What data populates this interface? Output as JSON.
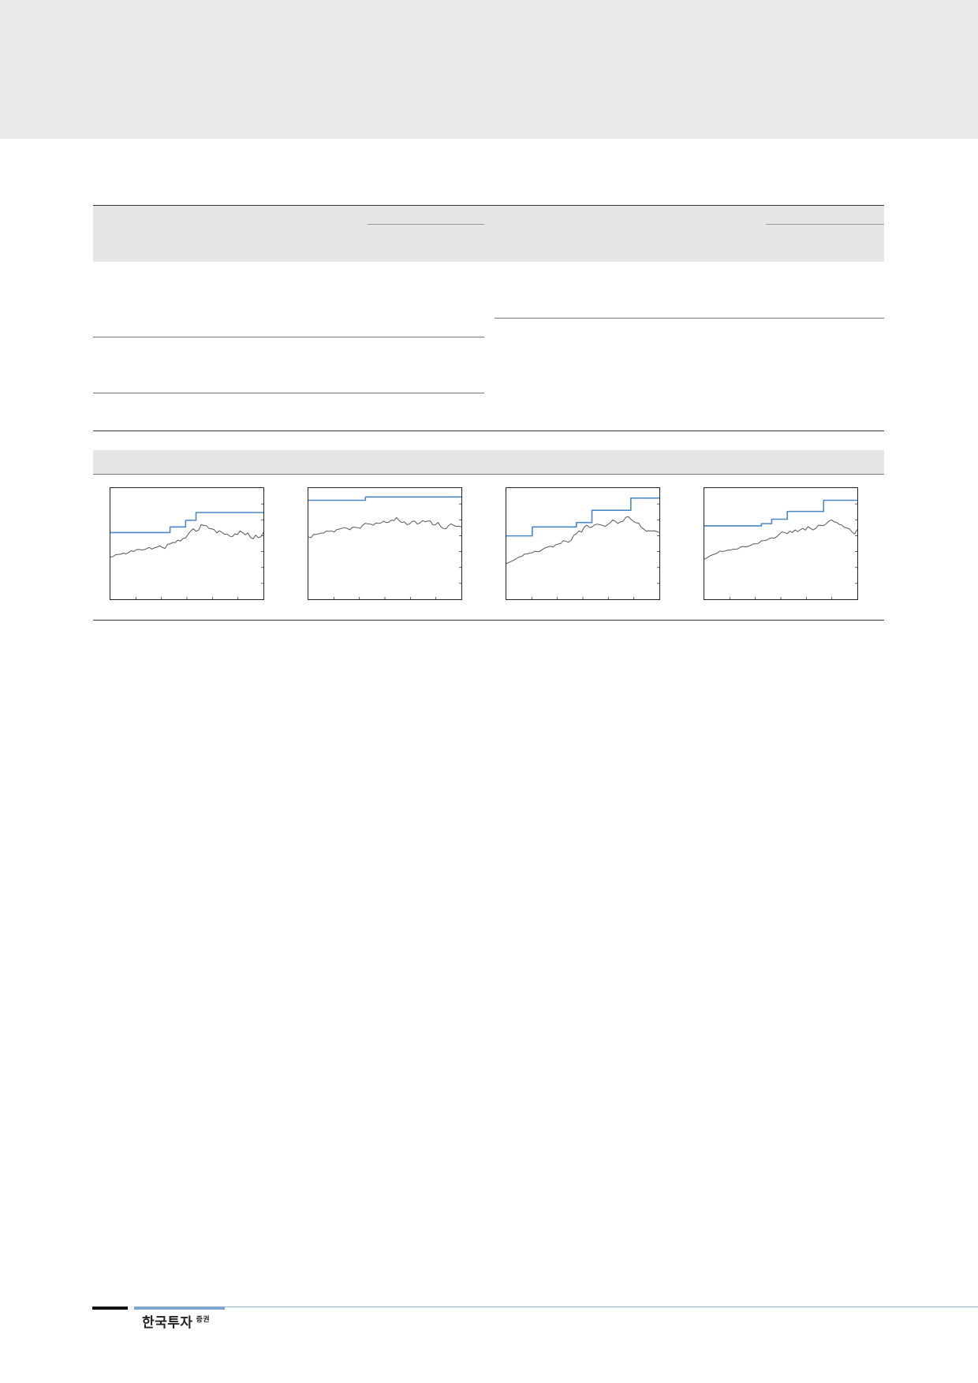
{
  "brand": {
    "name": "한국투자",
    "suffix": "증권"
  },
  "colors": {
    "target_price_line": "#4a86c8",
    "stock_price_line": "#555555",
    "band_gray": "#e6e6e6"
  },
  "chart_data": [
    {
      "type": "line",
      "ylim": [
        0,
        100
      ],
      "series": [
        {
          "values": [
            38.0,
            38.3,
            40.1,
            40.3,
            40.5,
            41.5,
            40.8,
            42.0,
            43.6,
            42.9,
            44.7,
            44.8,
            44.4,
            44.6,
            45.5,
            46.7,
            45.1,
            46.3,
            46.9,
            48.1,
            46.7,
            45.6,
            49.4,
            49.7,
            51.1,
            51.0,
            53.2,
            52.3,
            54.7,
            55.2,
            58.6,
            61.4,
            63.5,
            61.1,
            62.2,
            67.1,
            66.3,
            66.2,
            63.7,
            63.3,
            62.7,
            59.7,
            61.5,
            60.2,
            58.4,
            58.7,
            56.7,
            56.4,
            58.8,
            58.2,
            61.5,
            60.0,
            58.0,
            59.6,
            55.7,
            54.3,
            57.7,
            55.5,
            56.1,
            60.3
          ]
        },
        {
          "values": [
            60,
            60,
            60,
            60,
            60,
            60,
            60,
            60,
            60,
            60,
            60,
            60,
            60,
            60,
            60,
            60,
            60,
            60,
            60,
            60,
            60,
            60,
            60,
            65,
            65,
            65,
            65,
            65,
            65,
            71,
            71,
            71,
            71,
            78,
            78,
            78,
            78,
            78,
            78,
            78,
            78,
            78,
            78,
            78,
            78,
            78,
            78,
            78,
            78,
            78,
            78,
            78,
            78,
            78,
            78,
            78,
            78,
            78,
            78,
            78
          ]
        }
      ]
    },
    {
      "type": "line",
      "ylim": [
        0,
        100
      ],
      "series": [
        {
          "values": [
            56.0,
            55.4,
            58.3,
            58.3,
            58.9,
            59.5,
            59.7,
            61.4,
            61.1,
            61.3,
            60.5,
            62.8,
            63.2,
            63.8,
            64.5,
            63.6,
            62.5,
            64.8,
            64.7,
            64.4,
            63.8,
            66.8,
            68.3,
            67.7,
            67.6,
            66.6,
            68.5,
            68.3,
            68.6,
            70.2,
            69.0,
            69.2,
            71.2,
            70.7,
            73.5,
            70.7,
            69.0,
            69.6,
            67.1,
            67.6,
            70.1,
            70.3,
            67.7,
            68.6,
            70.8,
            69.7,
            70.3,
            70.5,
            66.8,
            67.1,
            69.1,
            65.4,
            63.7,
            63.3,
            66.1,
            67.8,
            66.5,
            65.5,
            65.7,
            65.2
          ]
        },
        {
          "values": [
            89,
            89,
            89,
            89,
            89,
            89,
            89,
            89,
            89,
            89,
            89,
            89,
            89,
            89,
            89,
            89,
            89,
            89,
            89,
            89,
            89,
            89,
            92,
            92,
            92,
            92,
            92,
            92,
            92,
            92,
            92,
            92,
            92,
            92,
            92,
            92,
            92,
            92,
            92,
            92,
            92,
            92,
            92,
            92,
            92,
            92,
            92,
            92,
            92,
            92,
            92,
            92,
            92,
            92,
            92,
            92,
            92,
            92,
            92,
            92
          ]
        }
      ]
    },
    {
      "type": "line",
      "ylim": [
        0,
        100
      ],
      "series": [
        {
          "values": [
            32.0,
            33.2,
            34.2,
            35.3,
            36.7,
            38.1,
            38.6,
            40.6,
            40.8,
            41.6,
            41.8,
            43.2,
            42.7,
            43.2,
            44.9,
            46.2,
            47.1,
            47.7,
            46.9,
            49.0,
            49.7,
            50.3,
            52.8,
            52.1,
            51.2,
            53.1,
            57.5,
            58.9,
            61.5,
            60.4,
            64.8,
            66.7,
            64.6,
            64.9,
            66.9,
            67.6,
            67.1,
            66.6,
            65.5,
            67.0,
            68.7,
            71.3,
            70.2,
            68.2,
            69.6,
            70.1,
            73.6,
            74.4,
            72.0,
            70.1,
            68.8,
            68.5,
            64.8,
            63.0,
            61.2,
            61.6,
            61.4,
            61.5,
            60.9,
            60.0
          ]
        },
        {
          "values": [
            57,
            57,
            57,
            57,
            57,
            57,
            57,
            57,
            57,
            57,
            65,
            65,
            65,
            65,
            65,
            65,
            65,
            65,
            65,
            65,
            65,
            65,
            65,
            65,
            65,
            65,
            65,
            69,
            69,
            69,
            69,
            69,
            69,
            80,
            80,
            80,
            80,
            80,
            80,
            80,
            80,
            80,
            80,
            80,
            80,
            80,
            80,
            80,
            91,
            91,
            91,
            91,
            91,
            91,
            91,
            91,
            91,
            91,
            91,
            91
          ]
        }
      ]
    },
    {
      "type": "line",
      "ylim": [
        0,
        100
      ],
      "series": [
        {
          "values": [
            36.0,
            37.2,
            38.8,
            39.8,
            40.6,
            41.6,
            43.3,
            43.0,
            43.4,
            44.2,
            44.1,
            45.0,
            44.9,
            45.4,
            47.0,
            47.4,
            47.1,
            47.7,
            48.6,
            49.8,
            49.8,
            50.5,
            52.6,
            52.8,
            53.1,
            54.5,
            55.2,
            55.0,
            56.4,
            58.7,
            60.6,
            59.9,
            59.0,
            61.3,
            60.1,
            62.4,
            60.8,
            62.5,
            63.7,
            62.2,
            65.3,
            63.6,
            62.4,
            63.8,
            66.5,
            66.5,
            66.2,
            67.9,
            70.2,
            71.4,
            69.8,
            69.2,
            67.4,
            66.7,
            64.7,
            64.1,
            63.2,
            60.4,
            58.7,
            62.9
          ]
        },
        {
          "values": [
            66,
            66,
            66,
            66,
            66,
            66,
            66,
            66,
            66,
            66,
            66,
            66,
            66,
            66,
            66,
            66,
            66,
            66,
            66,
            66,
            66,
            66,
            68,
            68,
            68,
            68,
            72,
            72,
            72,
            72,
            72,
            72,
            79,
            79,
            79,
            79,
            79,
            79,
            79,
            79,
            79,
            79,
            79,
            79,
            79,
            79,
            89,
            89,
            89,
            89,
            89,
            89,
            89,
            89,
            89,
            89,
            89,
            89,
            89,
            89
          ]
        }
      ]
    }
  ]
}
